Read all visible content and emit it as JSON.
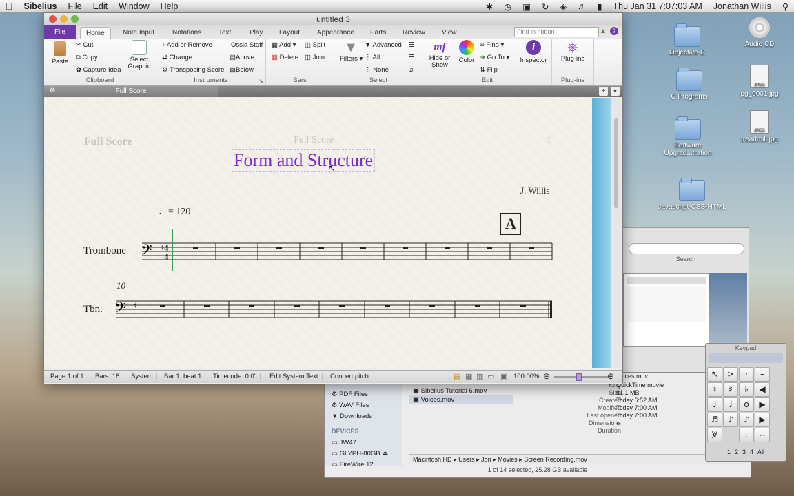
{
  "menubar": {
    "app": "Sibelius",
    "items": [
      "File",
      "Edit",
      "Window",
      "Help"
    ],
    "clock": "Thu Jan 31  7:07:03 AM",
    "user": "Jonathan Willis"
  },
  "desktop": {
    "icons": [
      "Objective-C",
      "C Programs",
      "Software Upgrad...tration",
      "Javascript-CSS-HTML",
      "Audio CD",
      "pg_0001.jpg",
      "treadmill.jpg"
    ],
    "doc_label": "JPEG"
  },
  "window": {
    "title": "untitled 3",
    "tabs": [
      "File",
      "Home",
      "Note Input",
      "Notations",
      "Text",
      "Play",
      "Layout",
      "Appearance",
      "Parts",
      "Review",
      "View"
    ],
    "find_placeholder": "Find in ribbon",
    "ribbon": {
      "clipboard": {
        "paste": "Paste",
        "cut": "Cut",
        "copy": "Copy",
        "capture": "Capture Idea",
        "select_graphic": "Select Graphic",
        "label": "Clipboard"
      },
      "instruments": {
        "add_remove": "Add or Remove",
        "change": "Change",
        "transposing": "Transposing Score",
        "ossia": "Ossia Staff",
        "above": "Above",
        "below": "Below",
        "label": "Instruments"
      },
      "bars": {
        "add": "Add",
        "delete": "Delete",
        "split": "Split",
        "join": "Join",
        "label": "Bars"
      },
      "select": {
        "filters": "Filters",
        "advanced": "Advanced",
        "all": "All",
        "none": "None",
        "label": "Select"
      },
      "edit": {
        "hide_show": "Hide or Show",
        "color": "Color",
        "find": "Find",
        "goto": "Go To",
        "flip": "Flip",
        "inspector": "Inspector",
        "label": "Edit"
      },
      "plugins": {
        "plugins": "Plug-ins",
        "label": "Plug-ins"
      }
    },
    "doc_tab": "Full Score"
  },
  "score": {
    "header_left": "Full Score",
    "header_center": "Full Score",
    "page_number": "1",
    "title": "Form and Structure",
    "composer": "J. Willis",
    "tempo": "= 120",
    "rehearsal": "A",
    "instrument_full": "Trombone",
    "instrument_short": "Tbn.",
    "bar_number": "10"
  },
  "statusbar": {
    "page": "Page 1 of 1",
    "bars": "Bars: 18",
    "system": "System",
    "position": "Bar 1, beat 1",
    "timecode": "Timecode: 0.0\"",
    "edit": "Edit System Text",
    "pitch": "Concert pitch",
    "zoom": "100.00%"
  },
  "finder": {
    "sidebar": [
      "PDF Files",
      "WAV Files",
      "Downloads"
    ],
    "devices_label": "DEVICES",
    "devices": [
      "JW47",
      "GLYPH-80GB",
      "FireWire 12"
    ],
    "files": [
      "Sibelius Tutorial 6.mov",
      "Voices.mov"
    ],
    "info": {
      "name": "Voices.mov",
      "kind_label": "Kind",
      "kind": "QuickTime movie",
      "size_label": "Size",
      "size": "81.1 MB",
      "created_label": "Created",
      "created": "Today 6:52 AM",
      "modified_label": "Modified",
      "modified": "Today 7:00 AM",
      "opened_label": "Last opened",
      "opened": "Today 7:00 AM",
      "dims_label": "Dimensions",
      "dims": "--",
      "dur_label": "Duration",
      "dur": "--"
    },
    "path": [
      "Macintosh HD",
      "Users",
      "Jon",
      "Movies",
      "Screen Recording.mov"
    ],
    "status": "1 of 14 selected, 25.28 GB available"
  },
  "search": {
    "label": "Search"
  },
  "keypad": {
    "title": "Keypad",
    "tabs": [
      "1",
      "2",
      "3",
      "4",
      "All"
    ]
  }
}
